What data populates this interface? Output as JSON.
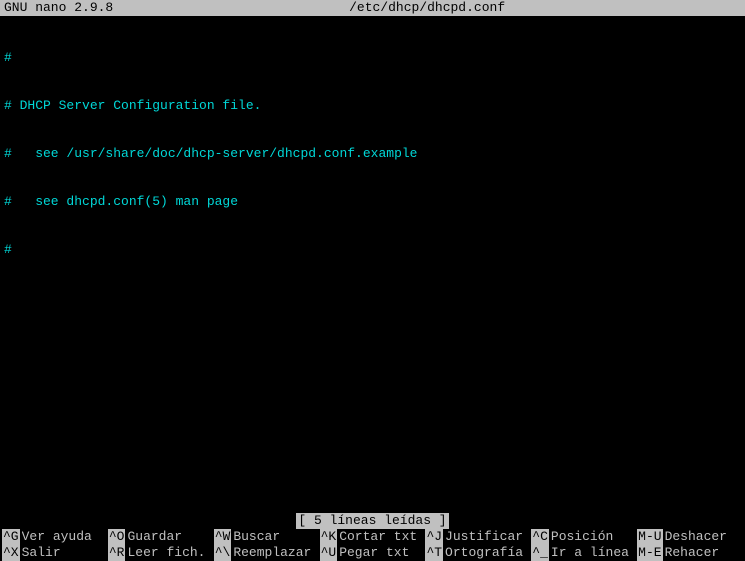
{
  "header": {
    "app_name": "GNU nano 2.9.8",
    "file_path": "/etc/dhcp/dhcpd.conf"
  },
  "editor": {
    "lines": [
      "#",
      "# DHCP Server Configuration file.",
      "#   see /usr/share/doc/dhcp-server/dhcpd.conf.example",
      "#   see dhcpd.conf(5) man page",
      "#"
    ]
  },
  "status": {
    "message": "[ 5 líneas leídas ]"
  },
  "shortcuts": {
    "row1": [
      {
        "key": "^G",
        "label": "Ver ayuda"
      },
      {
        "key": "^O",
        "label": "Guardar"
      },
      {
        "key": "^W",
        "label": "Buscar"
      },
      {
        "key": "^K",
        "label": "Cortar txt"
      },
      {
        "key": "^J",
        "label": "Justificar"
      },
      {
        "key": "^C",
        "label": "Posición"
      },
      {
        "key": "M-U",
        "label": "Deshacer"
      }
    ],
    "row2": [
      {
        "key": "^X",
        "label": "Salir"
      },
      {
        "key": "^R",
        "label": "Leer fich."
      },
      {
        "key": "^\\",
        "label": "Reemplazar"
      },
      {
        "key": "^U",
        "label": "Pegar txt"
      },
      {
        "key": "^T",
        "label": "Ortografía"
      },
      {
        "key": "^_",
        "label": "Ir a línea"
      },
      {
        "key": "M-E",
        "label": "Rehacer"
      }
    ]
  }
}
